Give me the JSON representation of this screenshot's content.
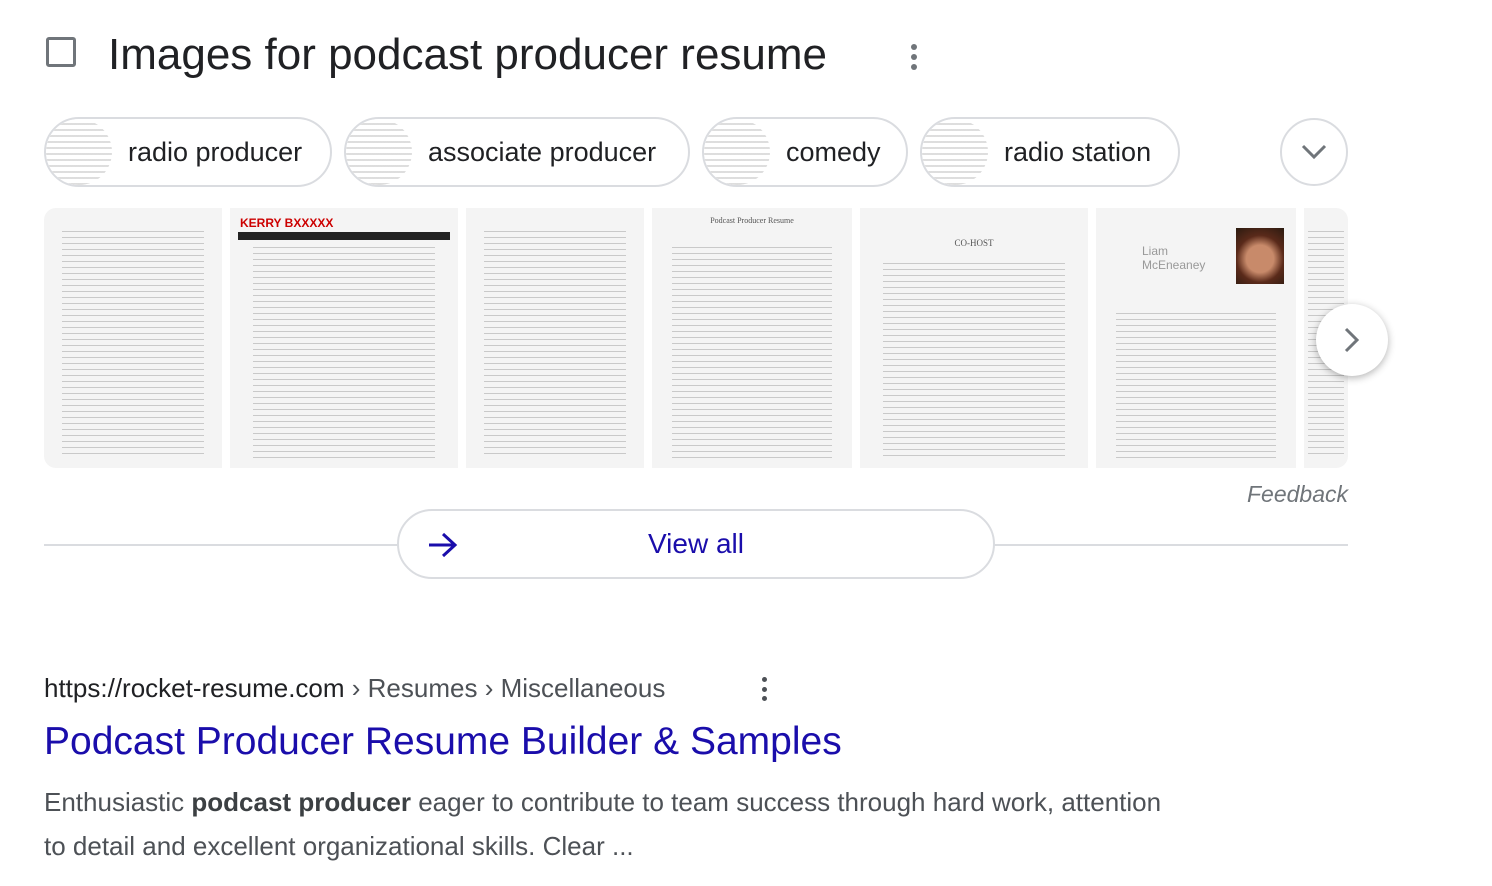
{
  "header": {
    "title": "Images for podcast producer resume",
    "icon": "image-icon",
    "menu_icon": "more-vert-icon"
  },
  "chips": [
    {
      "label": "radio producer"
    },
    {
      "label": "associate producer"
    },
    {
      "label": "comedy"
    },
    {
      "label": "radio station"
    }
  ],
  "thumbnails": [
    {
      "text": "KERRY BXXXXX"
    },
    {
      "text": "Podcast Producer Resume"
    },
    {
      "text": "CO-HOST"
    },
    {
      "text": "Liam McEneaney"
    }
  ],
  "feedback": "Feedback",
  "view_all": "View all",
  "result": {
    "url": "https://rocket-resume.com",
    "breadcrumb": " › Resumes › Miscellaneous",
    "title": "Podcast Producer Resume Builder & Samples",
    "snippet_pre": "Enthusiastic ",
    "snippet_bold": "podcast producer",
    "snippet_post": " eager to contribute to team success through hard work, attention to detail and excellent organizational skills. Clear ..."
  },
  "colors": {
    "link": "#1a0dab",
    "border": "#dadce0"
  }
}
